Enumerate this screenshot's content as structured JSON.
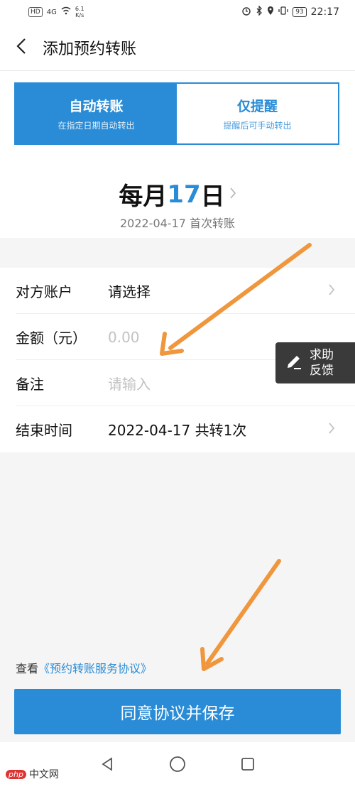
{
  "status_bar": {
    "left_badge": "HD",
    "signal": "4G",
    "speed_top": "6.1",
    "speed_bottom": "K/s",
    "battery": "93",
    "time": "22:17"
  },
  "header": {
    "back_icon": "chevron-left-icon",
    "title": "添加预约转账"
  },
  "modes": [
    {
      "title": "自动转账",
      "subtitle": "在指定日期自动转出",
      "active": true
    },
    {
      "title": "仅提醒",
      "subtitle": "提醒后可手动转出",
      "active": false
    }
  ],
  "schedule": {
    "prefix": "每月",
    "day": "17",
    "suffix": "日",
    "first_transfer": "2022-04-17 首次转账"
  },
  "form": {
    "account": {
      "label": "对方账户",
      "value": "请选择"
    },
    "amount": {
      "label": "金额（元）",
      "placeholder": "0.00"
    },
    "note": {
      "label": "备注",
      "placeholder": "请输入"
    },
    "end_time": {
      "label": "结束时间",
      "value": "2022-04-17 共转1次"
    }
  },
  "help": {
    "icon": "edit-icon",
    "line1": "求助",
    "line2": "反馈"
  },
  "agreement": {
    "prefix": "查看",
    "link": "《预约转账服务协议》"
  },
  "save_button": "同意协议并保存",
  "watermark": {
    "badge": "php",
    "text": "中文网"
  },
  "colors": {
    "accent": "#2a8cd6",
    "annotation_arrow": "#f0963c"
  }
}
